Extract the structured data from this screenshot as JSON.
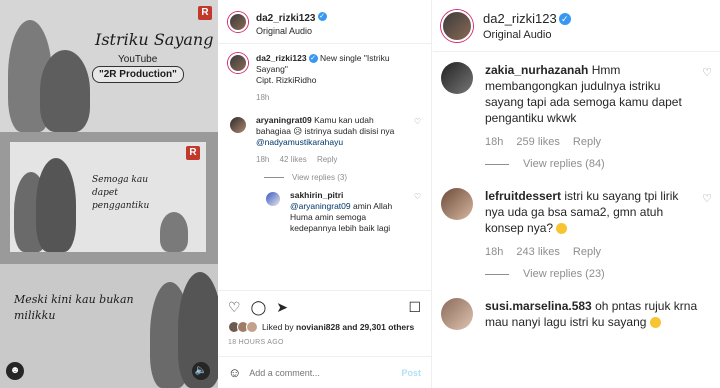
{
  "media": {
    "frame1_title": "Istriku Sayang",
    "frame1_youtube": "YouTube",
    "frame1_production": "\"2R Production\"",
    "frame2_text": "Semoga kau dapet penggantiku",
    "frame3_text": "Meski kini kau bukan milikku"
  },
  "post": {
    "username": "da2_rizki123",
    "audio": "Original Audio",
    "caption_user": "da2_rizki123",
    "caption_text": "New single \"Istriku Sayang\"",
    "caption_credit": "Cipt. RizkiRidho",
    "caption_time": "18h",
    "comments": [
      {
        "user": "aryaningrat09",
        "text": "Kamu kan udah bahagiaa 😥 istrinya sudah disisi nya",
        "mention": "@nadyamustikarahayu",
        "time": "18h",
        "likes": "42 likes",
        "reply": "Reply",
        "view_replies": "View replies (3)"
      },
      {
        "user": "sakhirin_pitri",
        "mention": "@aryaningrat09",
        "text": "amin Allah Huma amin semoga kedepannya lebih baik lagi"
      }
    ],
    "liked_by_prefix": "Liked by",
    "liked_by_user": "noviani828",
    "liked_by_suffix": "and 29,301 others",
    "time_ago": "18 HOURS AGO",
    "add_comment_placeholder": "Add a comment...",
    "post_button": "Post"
  },
  "zoom": {
    "username": "da2_rizki123",
    "audio": "Original Audio",
    "comments": [
      {
        "user": "zakia_nurhazanah",
        "text": "Hmm membangongkan judulnya istriku sayang tapi ada semoga kamu dapet pengantiku wkwk",
        "time": "18h",
        "likes": "259 likes",
        "reply": "Reply",
        "view_replies": "View replies (84)"
      },
      {
        "user": "lefruitdessert",
        "text": "istri ku sayang tpi lirik nya uda ga bsa sama2, gmn atuh konsep nya?",
        "time": "18h",
        "likes": "243 likes",
        "reply": "Reply",
        "view_replies": "View replies (23)"
      },
      {
        "user": "susi.marselina.583",
        "text": "oh pntas rujuk krna mau nanyi lagu istri ku sayang"
      }
    ]
  }
}
